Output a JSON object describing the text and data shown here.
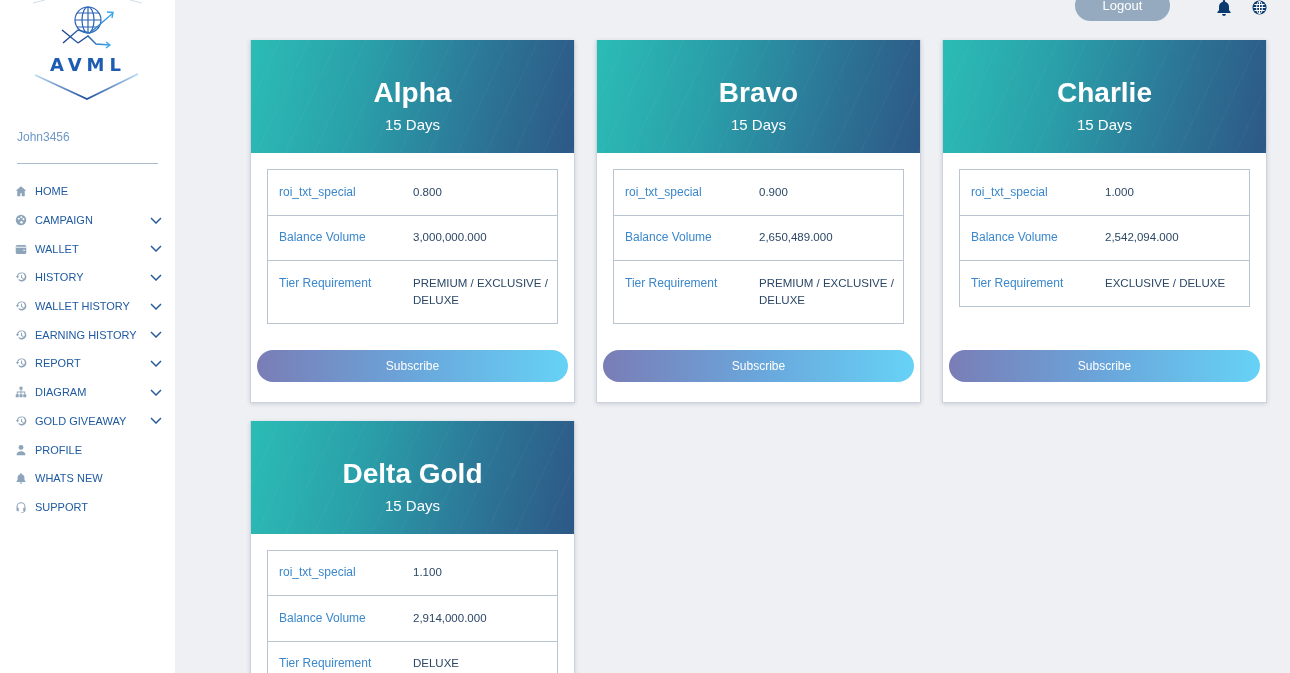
{
  "sidebar": {
    "logo_text": "AVML",
    "username": "John3456",
    "items": [
      {
        "label": "HOME",
        "submenu": false
      },
      {
        "label": "CAMPAIGN",
        "submenu": true
      },
      {
        "label": "WALLET",
        "submenu": true
      },
      {
        "label": "HISTORY",
        "submenu": true
      },
      {
        "label": "WALLET HISTORY",
        "submenu": true
      },
      {
        "label": "EARNING HISTORY",
        "submenu": true
      },
      {
        "label": "REPORT",
        "submenu": true
      },
      {
        "label": "DIAGRAM",
        "submenu": true
      },
      {
        "label": "GOLD GIVEAWAY",
        "submenu": true
      },
      {
        "label": "PROFILE",
        "submenu": false
      },
      {
        "label": "WHATS NEW",
        "submenu": false
      },
      {
        "label": "SUPPORT",
        "submenu": false
      }
    ]
  },
  "topbar": {
    "logout_button": "Logout"
  },
  "plans": [
    {
      "name": "Alpha",
      "duration": "15 Days",
      "details": [
        {
          "label": "roi_txt_special",
          "value": "0.800"
        },
        {
          "label": "Balance Volume",
          "value": "3,000,000.000"
        },
        {
          "label": "Tier Requirement",
          "value": "PREMIUM / EXCLUSIVE / DELUXE"
        }
      ],
      "button": "Subscribe"
    },
    {
      "name": "Bravo",
      "duration": "15 Days",
      "details": [
        {
          "label": "roi_txt_special",
          "value": "0.900"
        },
        {
          "label": "Balance Volume",
          "value": "2,650,489.000"
        },
        {
          "label": "Tier Requirement",
          "value": "PREMIUM / EXCLUSIVE / DELUXE"
        }
      ],
      "button": "Subscribe"
    },
    {
      "name": "Charlie",
      "duration": "15 Days",
      "details": [
        {
          "label": "roi_txt_special",
          "value": "1.000"
        },
        {
          "label": "Balance Volume",
          "value": "2,542,094.000"
        },
        {
          "label": "Tier Requirement",
          "value": "EXCLUSIVE / DELUXE"
        }
      ],
      "button": "Subscribe"
    },
    {
      "name": "Delta Gold",
      "duration": "15 Days",
      "details": [
        {
          "label": "roi_txt_special",
          "value": "1.100"
        },
        {
          "label": "Balance Volume",
          "value": "2,914,000.000"
        },
        {
          "label": "Tier Requirement",
          "value": "DELUXE"
        }
      ]
    }
  ]
}
